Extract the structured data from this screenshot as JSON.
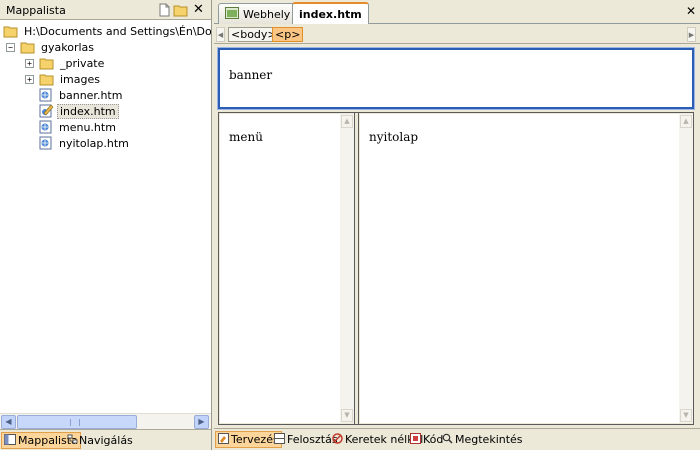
{
  "left_pane": {
    "title": "Mappalista",
    "tree": {
      "root": "H:\\Documents and Settings\\Én\\Dokumentu",
      "project": "gyakorlas",
      "items": [
        {
          "label": "_private",
          "icon": "folder-icon",
          "expandable": true
        },
        {
          "label": "images",
          "icon": "folder-icon",
          "expandable": true
        },
        {
          "label": "banner.htm",
          "icon": "html-file-icon"
        },
        {
          "label": "index.htm",
          "icon": "html-file-edit-icon",
          "selected": true
        },
        {
          "label": "menu.htm",
          "icon": "html-file-icon"
        },
        {
          "label": "nyitolap.htm",
          "icon": "html-file-icon"
        }
      ]
    },
    "bottom_tabs": [
      "Mappalista",
      "Navigálás"
    ]
  },
  "editor": {
    "doc_tabs": [
      "Webhely",
      "index.htm"
    ],
    "tag_path": [
      "<body>",
      "<p>"
    ],
    "frames": {
      "banner": "banner",
      "menu": "menü",
      "main": "nyitolap"
    },
    "view_tabs": [
      "Tervezés",
      "Felosztás",
      "Keretek nélkül",
      "Kód",
      "Megtekintés"
    ]
  },
  "colors": {
    "chrome": "#ECE9D8",
    "active_tab_orange": "#FBD59A",
    "frame_border_blue": "#2C5DB5"
  }
}
